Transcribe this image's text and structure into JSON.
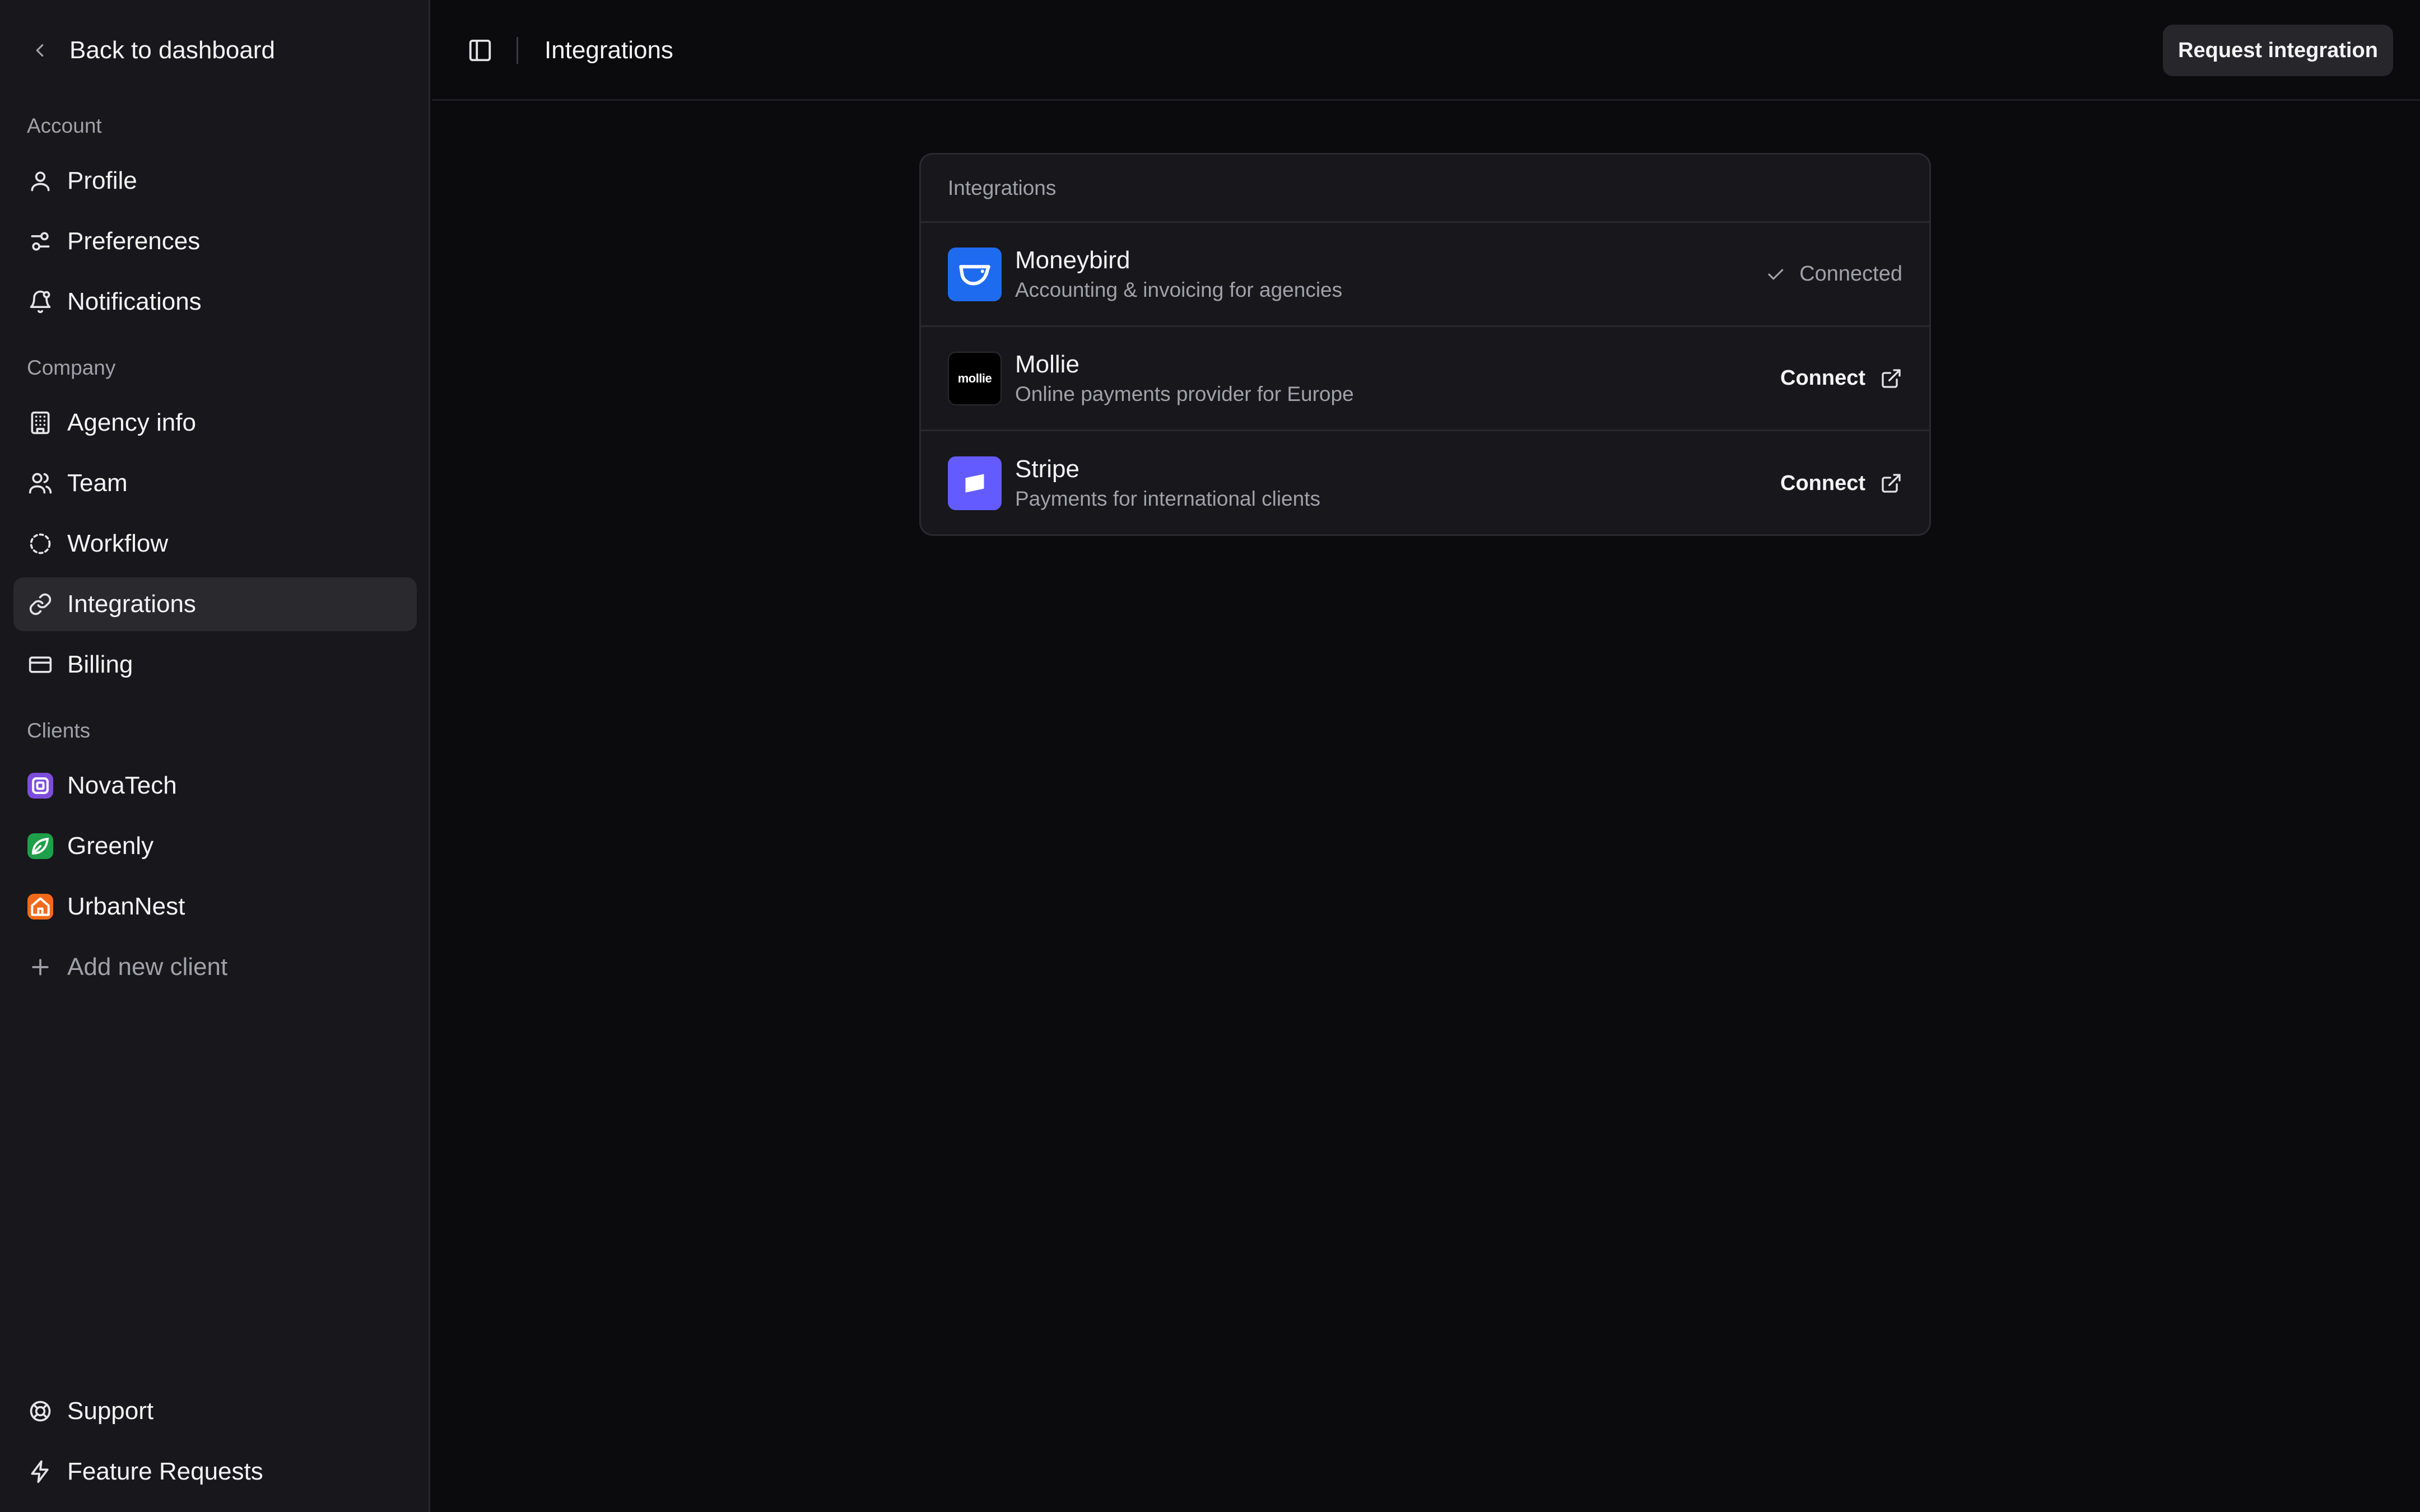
{
  "colors": {
    "background": "#0b0a0d",
    "sidebar": "#18171b",
    "active_item": "#2a292e",
    "moneybird": "#1f6bf0",
    "mollie": "#000000",
    "stripe": "#635bff",
    "novatech": "#7c4ddb",
    "greenly": "#1f9f4a",
    "urbannest": "#f06a1a"
  },
  "sidebar": {
    "back_label": "Back to dashboard",
    "sections": {
      "account": "Account",
      "company": "Company",
      "clients": "Clients"
    },
    "account_items": [
      {
        "label": "Profile",
        "icon": "user-icon"
      },
      {
        "label": "Preferences",
        "icon": "sliders-icon"
      },
      {
        "label": "Notifications",
        "icon": "bell-icon"
      }
    ],
    "company_items": [
      {
        "label": "Agency info",
        "icon": "building-icon"
      },
      {
        "label": "Team",
        "icon": "users-icon"
      },
      {
        "label": "Workflow",
        "icon": "dashed-circle-icon"
      },
      {
        "label": "Integrations",
        "icon": "link-icon",
        "active": true
      },
      {
        "label": "Billing",
        "icon": "credit-card-icon"
      }
    ],
    "clients": [
      {
        "label": "NovaTech"
      },
      {
        "label": "Greenly"
      },
      {
        "label": "UrbanNest"
      }
    ],
    "add_client": "Add new client",
    "footer_items": [
      {
        "label": "Support",
        "icon": "life-buoy-icon"
      },
      {
        "label": "Feature Requests",
        "icon": "zap-icon"
      }
    ]
  },
  "header": {
    "title": "Integrations",
    "request_button": "Request integration"
  },
  "integrations": {
    "heading": "Integrations",
    "items": [
      {
        "name": "Moneybird",
        "description": "Accounting & invoicing for agencies",
        "status": "Connected",
        "logo_text": ""
      },
      {
        "name": "Mollie",
        "description": "Online payments provider for Europe",
        "action": "Connect",
        "logo_text": "mollie"
      },
      {
        "name": "Stripe",
        "description": "Payments for international clients",
        "action": "Connect",
        "logo_text": ""
      }
    ]
  }
}
